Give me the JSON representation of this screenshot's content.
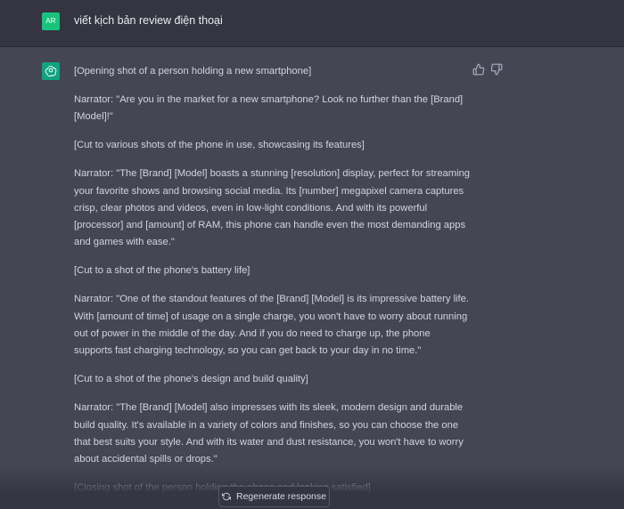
{
  "user": {
    "avatar_initials": "AR",
    "message": "viết kịch bản review điện thoại"
  },
  "assistant": {
    "paragraphs": [
      "[Opening shot of a person holding a new smartphone]",
      "Narrator: \"Are you in the market for a new smartphone? Look no further than the [Brand] [Model]!\"",
      "[Cut to various shots of the phone in use, showcasing its features]",
      "Narrator: \"The [Brand] [Model] boasts a stunning [resolution] display, perfect for streaming your favorite shows and browsing social media. Its [number] megapixel camera captures crisp, clear photos and videos, even in low-light conditions. And with its powerful [processor] and [amount] of RAM, this phone can handle even the most demanding apps and games with ease.\"",
      "[Cut to a shot of the phone's battery life]",
      "Narrator: \"One of the standout features of the [Brand] [Model] is its impressive battery life. With [amount of time] of usage on a single charge, you won't have to worry about running out of power in the middle of the day. And if you do need to charge up, the phone supports fast charging technology, so you can get back to your day in no time.\"",
      "[Cut to a shot of the phone's design and build quality]",
      "Narrator: \"The [Brand] [Model] also impresses with its sleek, modern design and durable build quality. It's available in a variety of colors and finishes, so you can choose the one that best suits your style. And with its water and dust resistance, you won't have to worry about accidental spills or drops.\"",
      "[Closing shot of the person holding the phone and looking satisfied]"
    ]
  },
  "controls": {
    "regenerate_label": "Regenerate response",
    "thumbs_up_icon": "thumbs-up-icon",
    "thumbs_down_icon": "thumbs-down-icon",
    "refresh_icon": "refresh-icon"
  },
  "colors": {
    "background": "#343541",
    "assistant_background": "#444654",
    "user_avatar": "#19c37d",
    "assistant_avatar": "#10a37f"
  }
}
